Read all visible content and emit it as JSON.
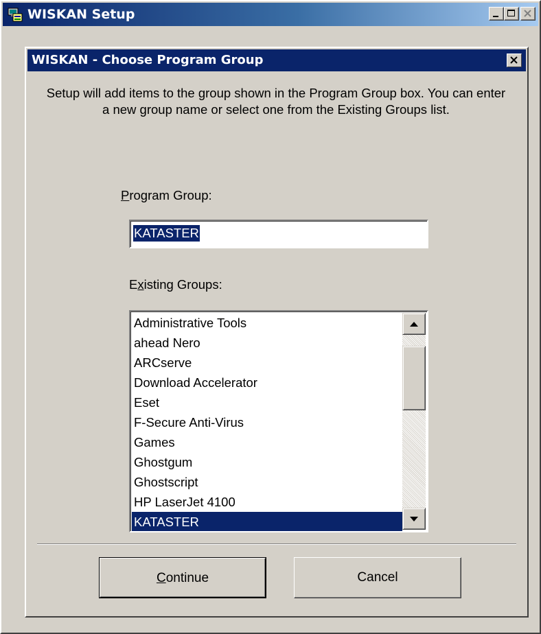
{
  "window": {
    "title": "WISKAN Setup",
    "controls": {
      "minimize_icon": "minimize-icon",
      "maximize_icon": "maximize-icon",
      "close_icon": "close-icon"
    }
  },
  "dialog": {
    "title": "WISKAN - Choose Program Group",
    "instructions": "Setup will add items to the group shown in the Program Group box. You can enter a new group name or select one from the Existing Groups list.",
    "program_group_label_mnemonic": "P",
    "program_group_label_rest": "rogram Group:",
    "program_group_value": "KATASTER",
    "existing_groups_label_before": "E",
    "existing_groups_label_mnemonic": "x",
    "existing_groups_label_rest": "isting Groups:",
    "existing_groups": [
      "Administrative Tools",
      "ahead Nero",
      "ARCserve",
      "Download Accelerator",
      "Eset",
      "F-Secure Anti-Virus",
      "Games",
      "Ghostgum",
      "Ghostscript",
      "HP LaserJet 4100",
      "KATASTER"
    ],
    "selected_group": "KATASTER",
    "continue_mnemonic": "C",
    "continue_rest": "ontinue",
    "cancel_label": "Cancel"
  },
  "colors": {
    "face": "#d4d0c8",
    "title_active": "#0a246a",
    "selection": "#0a246a"
  }
}
